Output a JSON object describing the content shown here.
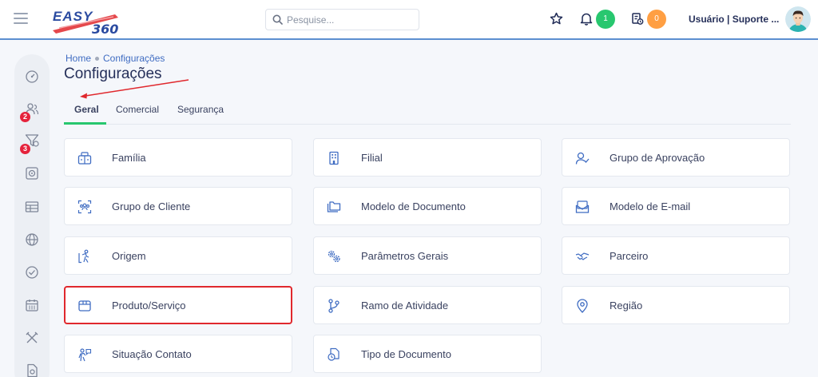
{
  "header": {
    "search_placeholder": "Pesquise...",
    "notifications_count": "1",
    "tasks_count": "0",
    "user_label": "Usuário | Suporte ...",
    "colors": {
      "accent": "#5b8fd0",
      "notif": "#28c76f",
      "tasks": "#ff9f43"
    }
  },
  "logo": {
    "text": "EASY",
    "suffix": "360"
  },
  "sidebar": {
    "items": [
      {
        "icon": "dashboard-icon"
      },
      {
        "icon": "users-icon",
        "badge": "2"
      },
      {
        "icon": "funnel-icon",
        "badge": "3"
      },
      {
        "icon": "target-icon"
      },
      {
        "icon": "table-icon"
      },
      {
        "icon": "globe-icon"
      },
      {
        "icon": "check-circle-icon"
      },
      {
        "icon": "calendar-icon"
      },
      {
        "icon": "tools-icon"
      },
      {
        "icon": "document-icon"
      }
    ]
  },
  "breadcrumb": {
    "home": "Home",
    "current": "Configurações"
  },
  "page": {
    "title": "Configurações"
  },
  "tabs": [
    {
      "label": "Geral",
      "active": true
    },
    {
      "label": "Comercial"
    },
    {
      "label": "Segurança"
    }
  ],
  "cards": [
    {
      "label": "Família",
      "icon": "family-icon"
    },
    {
      "label": "Filial",
      "icon": "building-icon"
    },
    {
      "label": "Grupo de Aprovação",
      "icon": "user-check-icon"
    },
    {
      "label": "Grupo de Cliente",
      "icon": "client-group-icon"
    },
    {
      "label": "Modelo de Documento",
      "icon": "folder-icon"
    },
    {
      "label": "Modelo de E-mail",
      "icon": "mail-icon"
    },
    {
      "label": "Origem",
      "icon": "origin-icon"
    },
    {
      "label": "Parâmetros Gerais",
      "icon": "gears-icon"
    },
    {
      "label": "Parceiro",
      "icon": "handshake-icon"
    },
    {
      "label": "Produto/Serviço",
      "icon": "box-icon",
      "highlighted": true
    },
    {
      "label": "Ramo de Atividade",
      "icon": "git-branch-icon"
    },
    {
      "label": "Região",
      "icon": "map-pin-icon"
    },
    {
      "label": "Situação Contato",
      "icon": "contact-status-icon"
    },
    {
      "label": "Tipo de Documento",
      "icon": "document-type-icon"
    }
  ],
  "annotation": {
    "color": "#e0282d",
    "points_to": "Geral"
  }
}
